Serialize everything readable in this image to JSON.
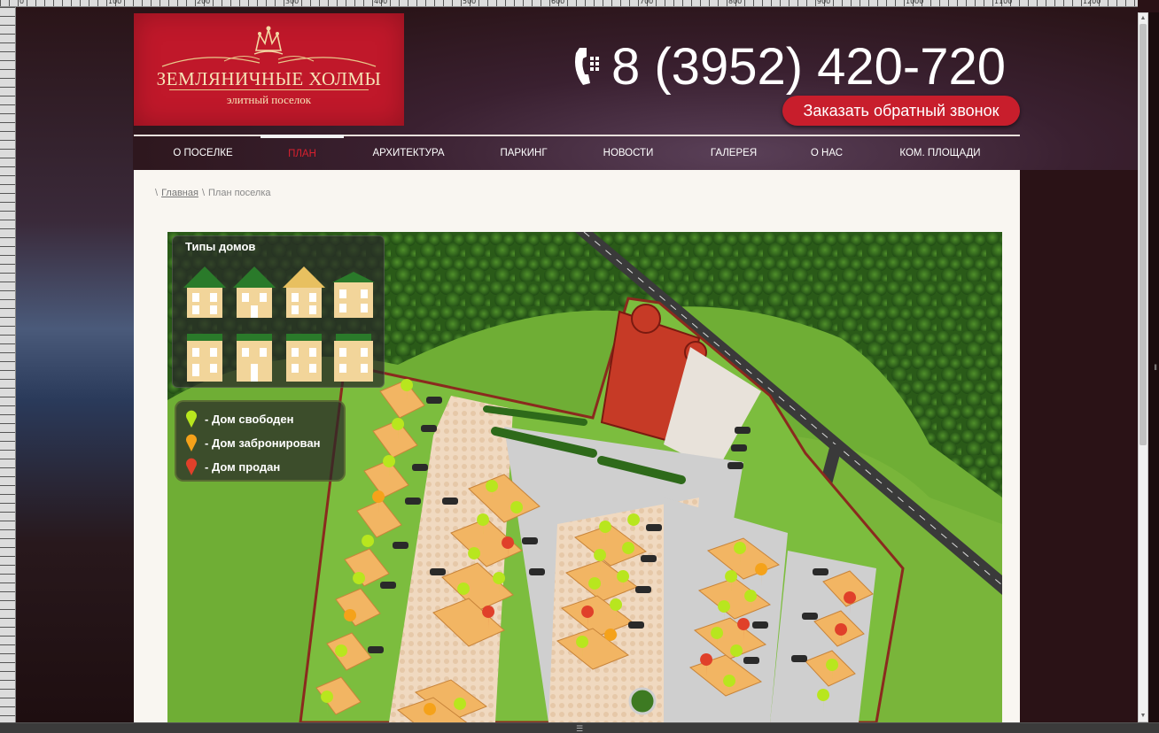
{
  "logo": {
    "title": "ЗЕМЛЯНИЧНЫЕ ХОЛМЫ",
    "subtitle": "элитный поселок"
  },
  "header": {
    "phone": "8 (3952) 420-720",
    "callback_label": "Заказать обратный звонок"
  },
  "nav": {
    "items": [
      {
        "label": "О ПОСЕЛКЕ"
      },
      {
        "label": "ПЛАН"
      },
      {
        "label": "АРХИТЕКТУРА"
      },
      {
        "label": "ПАРКИНГ"
      },
      {
        "label": "НОВОСТИ"
      },
      {
        "label": "ГАЛЕРЕЯ"
      },
      {
        "label": "О НАС"
      },
      {
        "label": "КОМ. ПЛОЩАДИ"
      }
    ],
    "active": "ПЛАН"
  },
  "breadcrumb": {
    "home": "Главная",
    "current": "План поселка"
  },
  "map": {
    "types_title": "Типы домов",
    "legend": [
      {
        "label": "- Дом свободен",
        "color": "#b8e61e"
      },
      {
        "label": "- Дом забронирован",
        "color": "#f5a21a"
      },
      {
        "label": "- Дом продан",
        "color": "#e0402a"
      }
    ]
  },
  "ruler": {
    "ticks": [
      "0",
      "100",
      "200",
      "300",
      "400",
      "500",
      "600",
      "700",
      "800",
      "900",
      "1000",
      "1100",
      "1200"
    ]
  }
}
